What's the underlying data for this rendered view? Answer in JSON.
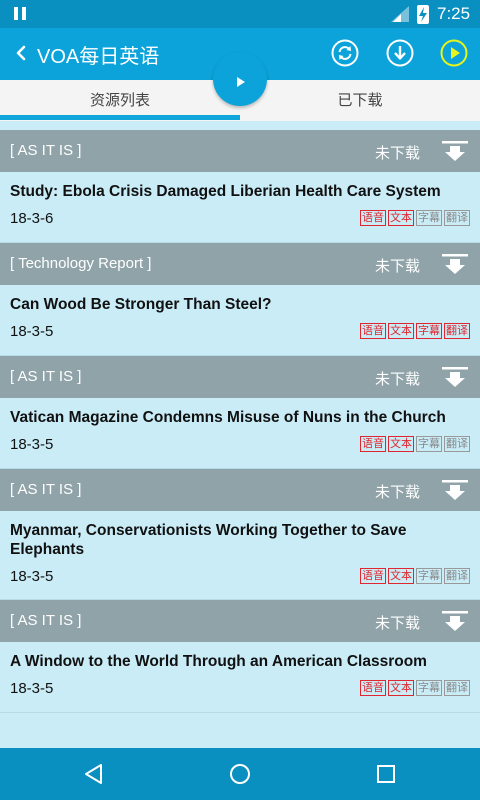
{
  "status": {
    "time": "7:25"
  },
  "app": {
    "title": "VOA每日英语"
  },
  "tabs": [
    {
      "label": "资源列表"
    },
    {
      "label": "已下载"
    }
  ],
  "items": [
    {
      "category": "[ AS IT IS ]",
      "download_status": "未下载",
      "title": "Study: Ebola Crisis Damaged Liberian Health Care System",
      "date": "18-3-6"
    },
    {
      "category": "[ Technology Report ]",
      "download_status": "未下载",
      "title": "Can Wood Be Stronger Than Steel?",
      "date": "18-3-5"
    },
    {
      "category": "[ AS IT IS ]",
      "download_status": "未下载",
      "title": "Vatican Magazine Condemns Misuse of Nuns in the Church",
      "date": "18-3-5"
    },
    {
      "category": "[ AS IT IS ]",
      "download_status": "未下载",
      "title": "Myanmar, Conservationists Working Together to Save Elephants",
      "date": "18-3-5"
    },
    {
      "category": "[ AS IT IS ]",
      "download_status": "未下载",
      "title": "A Window to the World Through an American Classroom",
      "date": "18-3-5"
    }
  ],
  "tags": {
    "audio": "语音",
    "text": "文本",
    "subtitle": "字幕",
    "translation": "翻译"
  },
  "colors": {
    "appbar": "#0ba3d9",
    "statusbar": "#0a8fc1",
    "header": "#8fa3a9",
    "list_bg": "#c9ecf7",
    "tag_active": "#e0262e",
    "tag_inactive": "#999999",
    "play_accent": "#e8f51c"
  }
}
